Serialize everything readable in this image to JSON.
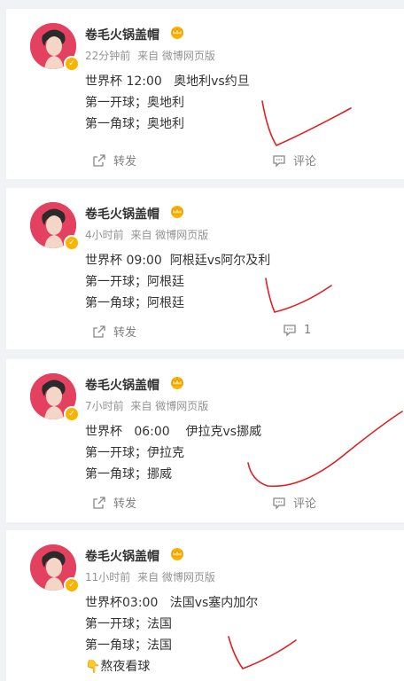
{
  "posts": [
    {
      "username": "卷毛火锅盖帽",
      "time": "22分钟前",
      "source": "来自 微博网页版",
      "lines": [
        "世界杯 12:00   奥地利vs约旦",
        "第一开球；奥地利",
        "第一角球；奥地利"
      ],
      "repost_label": "转发",
      "comment_label": "评论"
    },
    {
      "username": "卷毛火锅盖帽",
      "time": "4小时前",
      "source": "来自 微博网页版",
      "lines": [
        "世界杯 09:00  阿根廷vs阿尔及利",
        "第一开球；阿根廷",
        "第一角球；阿根廷"
      ],
      "repost_label": "转发",
      "comment_label": "1"
    },
    {
      "username": "卷毛火锅盖帽",
      "time": "7小时前",
      "source": "来自 微博网页版",
      "lines": [
        "世界杯   06:00    伊拉克vs挪威",
        "第一开球；伊拉克",
        "第一角球；挪威"
      ],
      "repost_label": "转发",
      "comment_label": "评论"
    },
    {
      "username": "卷毛火锅盖帽",
      "time": "11小时前",
      "source": "来自 微博网页版",
      "lines": [
        "世界杯03:00   法国vs塞内加尔",
        "第一开球；法国",
        "第一角球；法国",
        "👇熬夜看球"
      ],
      "repost_label": "",
      "comment_label": ""
    }
  ],
  "colors": {
    "avatar_bg": "#e4405f",
    "verified_badge": "#f7b500",
    "checkmark": "#e02020"
  },
  "icons": {
    "repost": "share-icon",
    "comment": "comment-icon",
    "crown": "crown-badge-icon"
  }
}
